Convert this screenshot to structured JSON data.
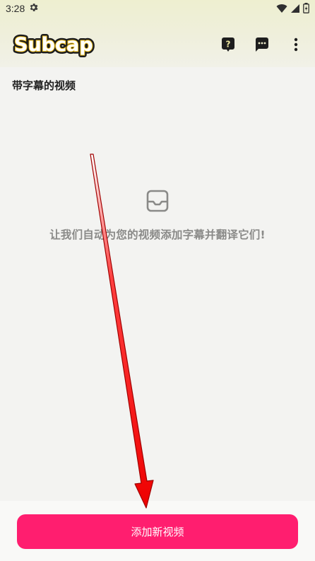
{
  "status_bar": {
    "time": "3:28",
    "icons": [
      "settings-gear-icon",
      "wifi-icon",
      "signal-icon",
      "battery-icon"
    ]
  },
  "app_bar": {
    "logo_text": "Subcap",
    "actions": [
      "help-icon",
      "feedback-chat-icon",
      "more-vert-icon"
    ],
    "help_glyph": "?"
  },
  "section": {
    "title": "带字幕的视频"
  },
  "empty_state": {
    "icon": "inbox-icon",
    "message": "让我们自动为您的视频添加字幕并翻译它们!"
  },
  "primary_action": {
    "label": "添加新视频",
    "color": "#ff1e6f"
  },
  "annotation": {
    "type": "red-arrow",
    "color": "#ff0000",
    "points_to": "add-new-video-button"
  }
}
